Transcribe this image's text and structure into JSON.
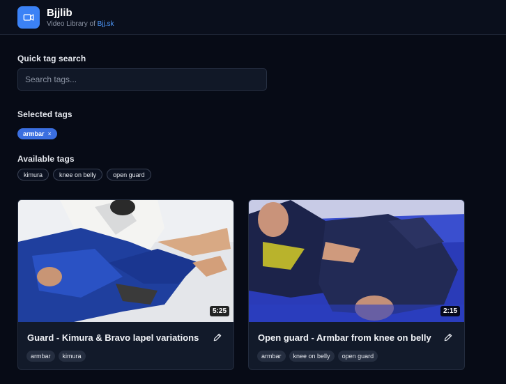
{
  "header": {
    "title": "Bjjlib",
    "subtitle_prefix": "Video Library of ",
    "subtitle_link": "Bjj.sk"
  },
  "search": {
    "label": "Quick tag search",
    "placeholder": "Search tags..."
  },
  "selected": {
    "label": "Selected tags",
    "tags": [
      "armbar"
    ],
    "remove_glyph": "×"
  },
  "available": {
    "label": "Available tags",
    "tags": [
      "kimura",
      "knee on belly",
      "open guard"
    ]
  },
  "videos": [
    {
      "title": "Guard - Kimura & Bravo lapel variations",
      "duration": "5:25",
      "tags": [
        "armbar",
        "kimura"
      ]
    },
    {
      "title": "Open guard - Armbar from knee on belly",
      "duration": "2:15",
      "tags": [
        "armbar",
        "knee on belly",
        "open guard"
      ]
    }
  ],
  "colors": {
    "accent": "#3b82f6",
    "background": "#070b16",
    "card": "#121a2a"
  },
  "icons": {
    "logo": "video-camera-icon",
    "edit": "pencil-icon"
  }
}
